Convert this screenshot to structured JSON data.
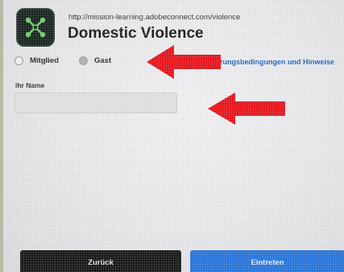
{
  "meeting": {
    "url": "http://mission-learning.adobeconnect.com/violence",
    "title": "Domestic Violence"
  },
  "login_type": {
    "options": [
      {
        "label": "Mitglied",
        "selected": false
      },
      {
        "label": "Gast",
        "selected": true
      }
    ]
  },
  "terms_link": "zungsbedingungen und Hinweise",
  "name_field": {
    "label": "Ihr Name",
    "value": ""
  },
  "buttons": {
    "back": "Zurück",
    "enter": "Eintreten"
  },
  "colors": {
    "link": "#1f63b8",
    "enter_button": "#2876db",
    "back_button": "#181818",
    "annotation_arrow": "#e8141b"
  },
  "icons": {
    "logo": "adobe-connect-logo-icon",
    "arrows": "red-arrow-icon"
  }
}
